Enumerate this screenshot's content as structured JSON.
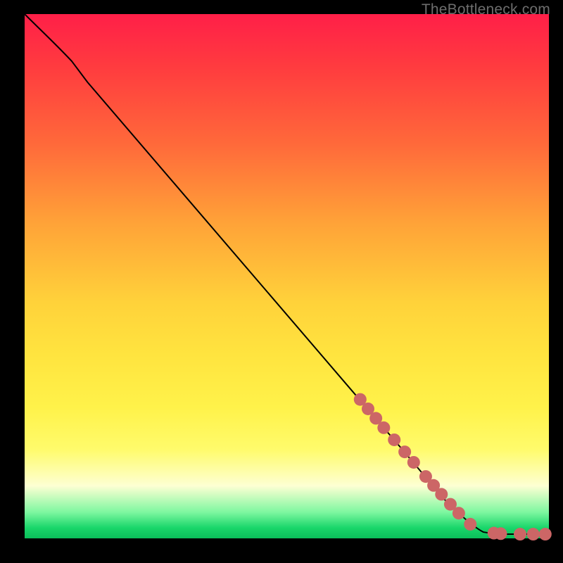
{
  "watermark": "TheBottleneck.com",
  "colors": {
    "background": "#000000",
    "gradient_top": "#ff1f48",
    "gradient_bottom": "#0bbf5a",
    "curve": "#000000",
    "dots": "#cc6666"
  },
  "chart_data": {
    "type": "line",
    "title": "",
    "xlabel": "",
    "ylabel": "",
    "xlim": [
      0,
      100
    ],
    "ylim": [
      0,
      100
    ],
    "grid": false,
    "legend": false,
    "curve": [
      {
        "x": 0,
        "y": 100
      },
      {
        "x": 3,
        "y": 97
      },
      {
        "x": 6,
        "y": 94.2
      },
      {
        "x": 9,
        "y": 91
      },
      {
        "x": 12,
        "y": 87
      },
      {
        "x": 60,
        "y": 31
      },
      {
        "x": 72,
        "y": 17
      },
      {
        "x": 80,
        "y": 7.5
      },
      {
        "x": 85,
        "y": 2.5
      },
      {
        "x": 87.5,
        "y": 1.2
      },
      {
        "x": 90,
        "y": 0.8
      },
      {
        "x": 95,
        "y": 0.8
      },
      {
        "x": 100,
        "y": 0.8
      }
    ],
    "dots": [
      {
        "x": 64,
        "y": 26.5
      },
      {
        "x": 65.5,
        "y": 24.7
      },
      {
        "x": 67,
        "y": 22.9
      },
      {
        "x": 68.5,
        "y": 21.1
      },
      {
        "x": 70.5,
        "y": 18.8
      },
      {
        "x": 72.5,
        "y": 16.5
      },
      {
        "x": 74.2,
        "y": 14.5
      },
      {
        "x": 76.5,
        "y": 11.8
      },
      {
        "x": 78,
        "y": 10.1
      },
      {
        "x": 79.5,
        "y": 8.4
      },
      {
        "x": 81.2,
        "y": 6.5
      },
      {
        "x": 82.8,
        "y": 4.8
      },
      {
        "x": 85,
        "y": 2.7
      },
      {
        "x": 89.5,
        "y": 1.0
      },
      {
        "x": 90.8,
        "y": 0.9
      },
      {
        "x": 94.5,
        "y": 0.8
      },
      {
        "x": 97,
        "y": 0.8
      },
      {
        "x": 99.3,
        "y": 0.8
      }
    ]
  }
}
